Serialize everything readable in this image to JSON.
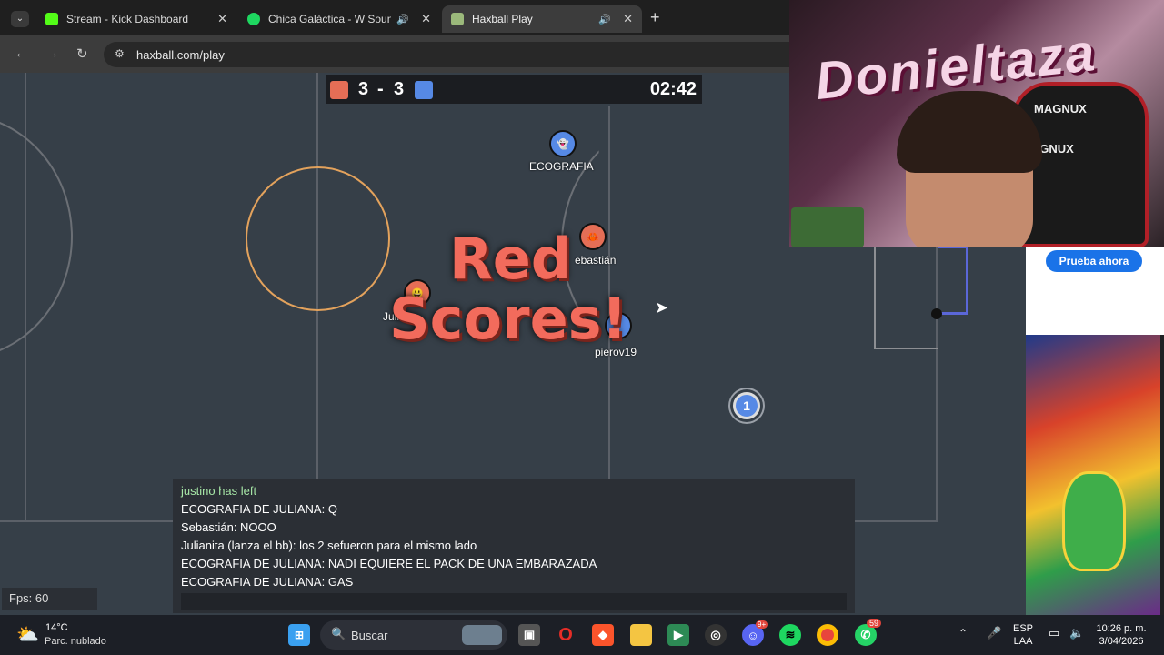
{
  "browser": {
    "tabs": [
      {
        "label": "Stream - Kick Dashboard",
        "favicon_color": "#53fc18"
      },
      {
        "label": "Chica Galáctica - W Sound",
        "favicon_color": "#1ed760"
      },
      {
        "label": "Haxball Play",
        "favicon_color": "#9bb97b"
      }
    ],
    "address": "haxball.com/play"
  },
  "game": {
    "score_red": "3",
    "score_sep": "-",
    "score_blue": "3",
    "timer": "02:42",
    "banner_line1": "Red",
    "banner_line2": "Scores!",
    "players": [
      {
        "name": "ECOGRAFIA",
        "team": "blue",
        "avatar": "ghost-icon"
      },
      {
        "name": "ebastián",
        "team": "red",
        "avatar": "crab-icon"
      },
      {
        "name": "Juli",
        "team": "red",
        "avatar": "face-icon"
      },
      {
        "name": "pierov19",
        "team": "blue",
        "avatar": ""
      },
      {
        "name": "",
        "team": "blue",
        "avatar": "1"
      }
    ],
    "fps": "Fps: 60",
    "colors": {
      "red": "#e56e56",
      "blue": "#5689e5"
    }
  },
  "chat": {
    "lines": [
      {
        "text": "justino has left",
        "kind": "system"
      },
      {
        "text": "ECOGRAFIA DE JULIANA: Q",
        "kind": "msg"
      },
      {
        "text": "Sebastián: NOOO",
        "kind": "msg"
      },
      {
        "text": "Julianita (lanza el bb): los 2 sefueron para el mismo lado",
        "kind": "msg"
      },
      {
        "text": "ECOGRAFIA DE JULIANA: NADI EQUIERE EL PACK DE UNA EMBARAZADA",
        "kind": "msg"
      },
      {
        "text": "ECOGRAFIA DE JULIANA: GAS",
        "kind": "msg"
      }
    ]
  },
  "webcam": {
    "wall_text": "Donieltaza",
    "chair_text": "MAGNUX"
  },
  "ad": {
    "button": "Prueba ahora"
  },
  "taskbar": {
    "weather_temp": "14°C",
    "weather_desc": "Parc. nublado",
    "search_placeholder": "Buscar",
    "lang_1": "ESP",
    "lang_2": "LAA",
    "time": "10:26 p. m.",
    "date": "3/04/2026",
    "whatsapp_badge": "59",
    "discord_badge": "9+"
  }
}
